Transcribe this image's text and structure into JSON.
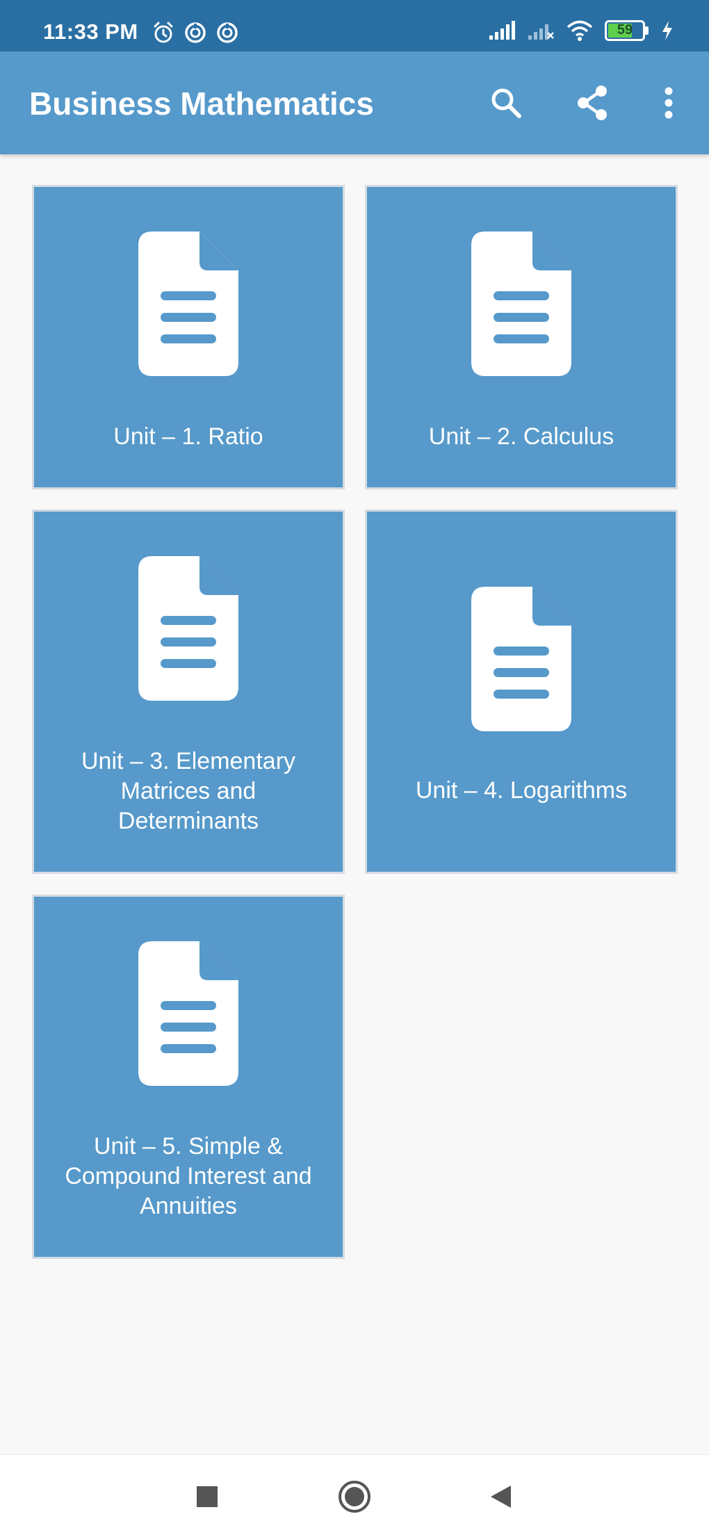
{
  "status_bar": {
    "time": "11:33 PM",
    "battery": "59",
    "left_icons": [
      "alarm-icon",
      "notification-icon",
      "notification-icon"
    ],
    "right_icons": [
      "signal-icon",
      "signal-off-icon",
      "wifi-icon",
      "battery-icon",
      "charging-icon"
    ]
  },
  "app_bar": {
    "title": "Business Mathematics",
    "actions": [
      "search-icon",
      "share-icon",
      "more-vert-icon"
    ]
  },
  "units": [
    {
      "label": "Unit – 1. Ratio",
      "icon": "document-icon"
    },
    {
      "label": "Unit – 2. Calculus",
      "icon": "document-icon"
    },
    {
      "label": "Unit – 3. Elementary Matrices and Determinants",
      "icon": "document-icon"
    },
    {
      "label": "Unit – 4. Logarithms",
      "icon": "document-icon"
    },
    {
      "label": "Unit – 5. Simple & Compound Interest and Annuities",
      "icon": "document-icon"
    }
  ],
  "nav_bar": {
    "buttons": [
      "recents-icon",
      "home-icon",
      "back-icon"
    ]
  },
  "colors": {
    "status_bar": "#2a6fa3",
    "app_bar": "#5699cb",
    "card": "#5699ca",
    "background": "#f8f8f9"
  }
}
